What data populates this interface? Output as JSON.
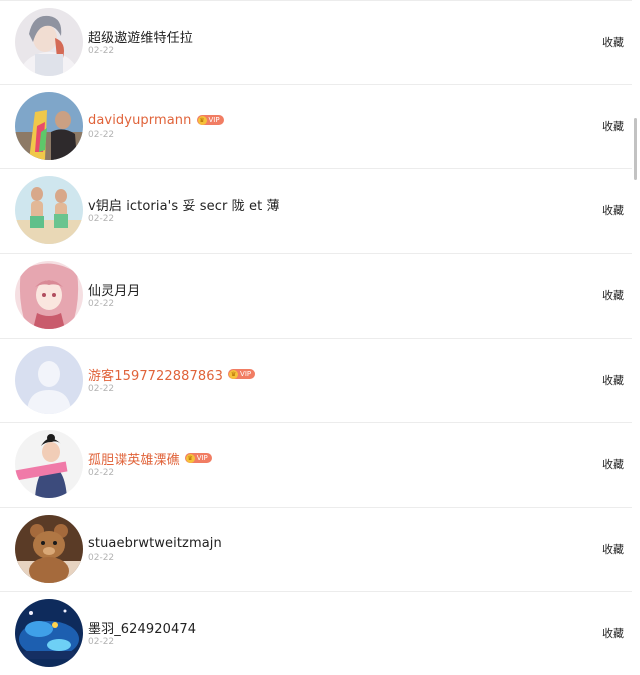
{
  "collect_label": "收藏",
  "vip_label": "VIP",
  "items": [
    {
      "name": "超级遨遊维特任拉",
      "date": "02-22",
      "vip": false,
      "avatar": "avatar-illustrated-boy"
    },
    {
      "name": "davidyuprmann",
      "date": "02-22",
      "vip": true,
      "avatar": "avatar-photo-man"
    },
    {
      "name": "v钥启 ictoria's 妥 secr 陇 et 薄",
      "date": "02-22",
      "vip": false,
      "avatar": "avatar-photo-couple"
    },
    {
      "name": "仙灵月月",
      "date": "02-22",
      "vip": false,
      "avatar": "avatar-anime-girl"
    },
    {
      "name": "游客1597722887863",
      "date": "02-22",
      "vip": true,
      "avatar": "avatar-default-placeholder"
    },
    {
      "name": "孤胆谍英雄溧礁",
      "date": "02-22",
      "vip": true,
      "avatar": "avatar-photo-girl"
    },
    {
      "name": "stuaebrwtweitzmajn",
      "date": "02-22",
      "vip": false,
      "avatar": "avatar-teddy-bear"
    },
    {
      "name": "墨羽_624920474",
      "date": "02-22",
      "vip": false,
      "avatar": "avatar-game-scene"
    }
  ],
  "colors": {
    "vip_name": "#e0633a",
    "normal_name": "#222222",
    "date": "#b3b3b3",
    "divider": "#ececec"
  }
}
